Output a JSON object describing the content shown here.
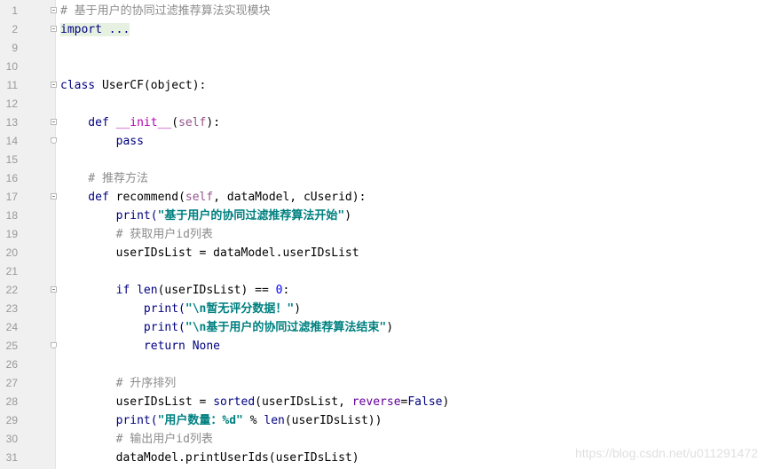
{
  "editor": {
    "lines": [
      {
        "n": "1",
        "tokens": [
          {
            "t": "# 基于用户的协同过滤推荐算法实现模块",
            "c": "cmt"
          }
        ]
      },
      {
        "n": "2",
        "tokens": [
          {
            "t": "import ...",
            "c": "imp"
          }
        ]
      },
      {
        "n": "9",
        "tokens": []
      },
      {
        "n": "10",
        "tokens": []
      },
      {
        "n": "11",
        "tokens": [
          {
            "t": "class ",
            "c": "kw"
          },
          {
            "t": "UserCF(object):",
            "c": ""
          }
        ]
      },
      {
        "n": "12",
        "tokens": []
      },
      {
        "n": "13",
        "tokens": [
          {
            "t": "    def ",
            "c": "kw"
          },
          {
            "t": "__init__",
            "c": "magic"
          },
          {
            "t": "(",
            "c": ""
          },
          {
            "t": "self",
            "c": "self"
          },
          {
            "t": "):",
            "c": ""
          }
        ]
      },
      {
        "n": "14",
        "tokens": [
          {
            "t": "        pass",
            "c": "kw"
          }
        ]
      },
      {
        "n": "15",
        "tokens": []
      },
      {
        "n": "16",
        "tokens": [
          {
            "t": "    # 推荐方法",
            "c": "cmt"
          }
        ]
      },
      {
        "n": "17",
        "tokens": [
          {
            "t": "    def ",
            "c": "kw"
          },
          {
            "t": "recommend(",
            "c": ""
          },
          {
            "t": "self",
            "c": "self"
          },
          {
            "t": ", dataModel, cUserid):",
            "c": ""
          }
        ]
      },
      {
        "n": "18",
        "tokens": [
          {
            "t": "        print(",
            "c": "kw"
          },
          {
            "t": "\"基于用户的协同过滤推荐算法开始\"",
            "c": "str"
          },
          {
            "t": ")",
            "c": ""
          }
        ]
      },
      {
        "n": "19",
        "tokens": [
          {
            "t": "        # 获取用户id列表",
            "c": "cmt"
          }
        ]
      },
      {
        "n": "20",
        "tokens": [
          {
            "t": "        userIDsList = dataModel.userIDsList",
            "c": ""
          }
        ]
      },
      {
        "n": "21",
        "tokens": []
      },
      {
        "n": "22",
        "tokens": [
          {
            "t": "        if ",
            "c": "kw"
          },
          {
            "t": "len",
            "c": "kw"
          },
          {
            "t": "(userIDsList) == ",
            "c": ""
          },
          {
            "t": "0",
            "c": "num"
          },
          {
            "t": ":",
            "c": ""
          }
        ]
      },
      {
        "n": "23",
        "tokens": [
          {
            "t": "            print(",
            "c": "kw"
          },
          {
            "t": "\"\\n暂无评分数据！\"",
            "c": "str"
          },
          {
            "t": ")",
            "c": ""
          }
        ]
      },
      {
        "n": "24",
        "tokens": [
          {
            "t": "            print(",
            "c": "kw"
          },
          {
            "t": "\"\\n基于用户的协同过滤推荐算法结束\"",
            "c": "str"
          },
          {
            "t": ")",
            "c": ""
          }
        ]
      },
      {
        "n": "25",
        "tokens": [
          {
            "t": "            return None",
            "c": "kw"
          }
        ]
      },
      {
        "n": "26",
        "tokens": []
      },
      {
        "n": "27",
        "tokens": [
          {
            "t": "        # 升序排列",
            "c": "cmt"
          }
        ]
      },
      {
        "n": "28",
        "tokens": [
          {
            "t": "        userIDsList = ",
            "c": ""
          },
          {
            "t": "sorted",
            "c": "kw"
          },
          {
            "t": "(userIDsList, ",
            "c": ""
          },
          {
            "t": "reverse",
            "c": "param"
          },
          {
            "t": "=",
            "c": ""
          },
          {
            "t": "False",
            "c": "kw"
          },
          {
            "t": ")",
            "c": ""
          }
        ]
      },
      {
        "n": "29",
        "tokens": [
          {
            "t": "        print(",
            "c": "kw"
          },
          {
            "t": "\"用户数量：%d\"",
            "c": "str"
          },
          {
            "t": " % ",
            "c": ""
          },
          {
            "t": "len",
            "c": "kw"
          },
          {
            "t": "(userIDsList))",
            "c": ""
          }
        ]
      },
      {
        "n": "30",
        "tokens": [
          {
            "t": "        # 输出用户id列表",
            "c": "cmt"
          }
        ]
      },
      {
        "n": "31",
        "tokens": [
          {
            "t": "        dataModel.printUserIds(userIDsList)",
            "c": ""
          }
        ]
      }
    ],
    "folds": {
      "1": "open",
      "2": "open",
      "11": "open",
      "13": "open",
      "14": "end",
      "17": "open",
      "22": "open",
      "25": "end"
    }
  },
  "watermark": "https://blog.csdn.net/u011291472"
}
